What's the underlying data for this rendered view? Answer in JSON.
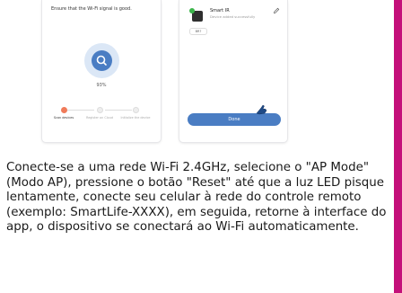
{
  "screens": {
    "left": {
      "hint": "Ensure that the Wi-Fi signal is good.",
      "progress_text": "93%",
      "progress_value": 0.93,
      "search_icon": "search-icon",
      "steps": [
        {
          "label": "Scan devices",
          "active": true
        },
        {
          "label": "Register on Cloud",
          "active": false
        },
        {
          "label": "Initialize the device",
          "active": false
        }
      ]
    },
    "right": {
      "device_name": "Smart IR",
      "device_status": "Device added successfully",
      "room_chip": "BR?",
      "done_label": "Done",
      "icons": [
        "device-icon",
        "check-icon",
        "edit-icon",
        "cursor-hand-icon"
      ]
    }
  },
  "instructions": "Conecte-se a uma rede Wi-Fi 2.4GHz, selecione o \"AP Mode\" (Modo AP), pressione o botão \"Reset\" até que a luz LED pisque lentamente, conecte seu celular à rede do controle remoto (exemplo: SmartLife-XXXX), em seguida, retorne à interface do app, o dispositivo se conectará ao Wi-Fi automaticamente.",
  "colors": {
    "accent": "#c4107a",
    "primary_blue": "#4a7dc3",
    "ring_blue": "#dbe7f6",
    "step_active": "#f07b5a",
    "success_green": "#3bb54a"
  }
}
